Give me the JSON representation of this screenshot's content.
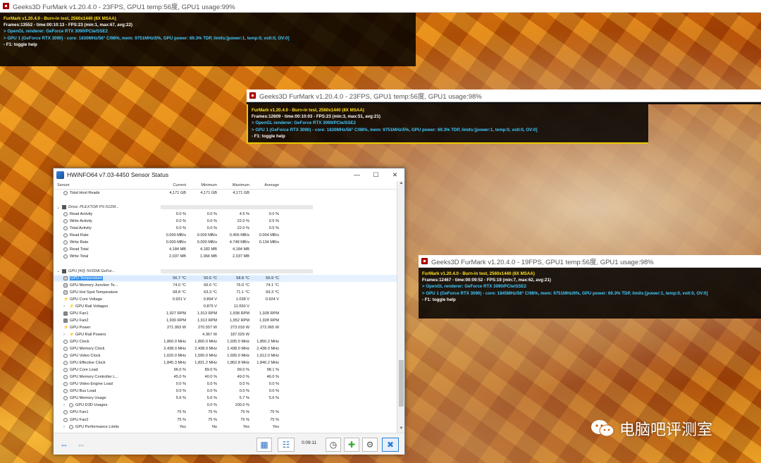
{
  "furmark_windows": [
    {
      "title": "Geeks3D FurMark v1.20.4.0 - 23FPS, GPU1 temp:56度, GPU1 usage:99%",
      "lines": [
        {
          "text": "FurMark v1.20.4.0 - Burn-in test, 2560x1440 (8X MSAA)",
          "color": "yellow"
        },
        {
          "text": "Frames:13552 - time:00:10:13 - FPS:23 (min:1, max:67, avg:22)",
          "color": "white"
        },
        {
          "text": "> OpenGL renderer: GeForce RTX 3090/PCIe/SSE2",
          "color": "cyan"
        },
        {
          "text": "> GPU 1 (GeForce RTX 3090) - core: 1830MHz/56° C/98%, mem: 9751MHz/5%, GPU power: 69.3% TDP, limits:[power:1, temp:0, volt:0, OV:0]",
          "color": "cyan"
        },
        {
          "text": "- F1: toggle help",
          "color": "white"
        }
      ]
    },
    {
      "title": "Geeks3D FurMark v1.20.4.0 - 23FPS, GPU1 temp:56度, GPU1 usage:98%",
      "lines": [
        {
          "text": "FurMark v1.20.4.0 - Burn-in test, 2560x1440 (8X MSAA)",
          "color": "yellow"
        },
        {
          "text": "Frames:12609 - time:00:10:03 - FPS:23 (min:3, max:51, avg:21)",
          "color": "white"
        },
        {
          "text": "> OpenGL renderer: GeForce RTX 3090/PCIe/SSE2",
          "color": "cyan"
        },
        {
          "text": "> GPU 1 (GeForce RTX 3090) - core: 1830MHz/56° C/98%, mem: 9751MHz/5%, GPU power: 69.3% TDP, limits:[power:1, temp:0, volt:0, OV:0]",
          "color": "cyan"
        },
        {
          "text": "- F1: toggle help",
          "color": "white"
        }
      ]
    },
    {
      "title": "Geeks3D FurMark v1.20.4.0 - 19FPS, GPU1 temp:56度, GPU1 usage:98%",
      "lines": [
        {
          "text": "FurMark v1.20.4.0 - Burn-in test, 2560x1440 (8X MSAA)",
          "color": "yellow"
        },
        {
          "text": "Frames:12467 - time:00:09:52 - FPS:19 (min:7, max:62, avg:21)",
          "color": "white"
        },
        {
          "text": "> OpenGL renderer: GeForce RTX 3090/PCIe/SSE2",
          "color": "cyan"
        },
        {
          "text": "> GPU 1 (GeForce RTX 3090) - core: 1845MHz/56° C/98%, mem: 9751MHz/6%, GPU power: 69.3% TDP, limits:[power:1, temp:0, volt:0, OV:0]",
          "color": "cyan"
        },
        {
          "text": "- F1: toggle help",
          "color": "white"
        }
      ]
    }
  ],
  "hwinfo": {
    "title": "HWiNFO64 v7.03-4450 Sensor Status",
    "columns": [
      "Sensor",
      "Current",
      "Minimum",
      "Maximum",
      "Average"
    ],
    "rows": [
      {
        "type": "item",
        "icon": "circle",
        "label": "Total Host Reads",
        "cur": "4,171 GB",
        "min": "4,171 GB",
        "max": "4,171 GB",
        "avg": ""
      },
      {
        "type": "blank"
      },
      {
        "type": "group",
        "label": "Drive: PLEXTOR PX-512M..."
      },
      {
        "type": "item",
        "icon": "circle",
        "label": "Read Activity",
        "cur": "0.0 %",
        "min": "0.0 %",
        "max": "4.5 %",
        "avg": "0.0 %"
      },
      {
        "type": "item",
        "icon": "circle",
        "label": "Write Activity",
        "cur": "0.0 %",
        "min": "0.0 %",
        "max": "22.0 %",
        "avg": "0.5 %"
      },
      {
        "type": "item",
        "icon": "circle",
        "label": "Total Activity",
        "cur": "0.0 %",
        "min": "0.0 %",
        "max": "22.0 %",
        "avg": "0.5 %"
      },
      {
        "type": "item",
        "icon": "circle",
        "label": "Read Rate",
        "cur": "0.000 MB/s",
        "min": "0.000 MB/s",
        "max": "0.456 MB/s",
        "avg": "0.004 MB/s"
      },
      {
        "type": "item",
        "icon": "circle",
        "label": "Write Rate",
        "cur": "0.000 MB/s",
        "min": "0.000 MB/s",
        "max": "4.748 MB/s",
        "avg": "0.134 MB/s"
      },
      {
        "type": "item",
        "icon": "circle",
        "label": "Read Total",
        "cur": "4,184 MB",
        "min": "4,182 MB",
        "max": "4,184 MB",
        "avg": ""
      },
      {
        "type": "item",
        "icon": "circle",
        "label": "Write Total",
        "cur": "2,037 MB",
        "min": "1,966 MB",
        "max": "2,037 MB",
        "avg": ""
      },
      {
        "type": "blank"
      },
      {
        "type": "group",
        "label": "GPU [#0]: NVIDIA GeFor..."
      },
      {
        "type": "item",
        "icon": "therm",
        "label": "GPU Temperature",
        "cur": "56.7 °C",
        "min": "50.5 °C",
        "max": "58.8 °C",
        "avg": "56.9 °C",
        "selected": true
      },
      {
        "type": "item",
        "icon": "therm",
        "label": "GPU Memory Junction Te...",
        "cur": "74.0 °C",
        "min": "66.0 °C",
        "max": "76.0 °C",
        "avg": "74.1 °C"
      },
      {
        "type": "item",
        "icon": "therm",
        "label": "GPU Hot Spot Temperature",
        "cur": "68.8 °C",
        "min": "63.3 °C",
        "max": "71.1 °C",
        "avg": "69.3 °C"
      },
      {
        "type": "item",
        "icon": "bolt",
        "label": "GPU Core Voltage",
        "cur": "0.931 V",
        "min": "0.894 V",
        "max": "1.038 V",
        "avg": "0.924 V"
      },
      {
        "type": "item",
        "icon": "bolt",
        "label": "GPU Rail Voltages",
        "cur": "",
        "min": "0.875 V",
        "max": "11.650 V",
        "avg": "",
        "expand": true
      },
      {
        "type": "item",
        "icon": "fan",
        "label": "GPU Fan1",
        "cur": "1,927 RPM",
        "min": "1,913 RPM",
        "max": "1,938 RPM",
        "avg": "1,928 RPM"
      },
      {
        "type": "item",
        "icon": "fan",
        "label": "GPU Fan2",
        "cur": "1,930 RPM",
        "min": "1,913 RPM",
        "max": "1,952 RPM",
        "avg": "1,928 RPM"
      },
      {
        "type": "item",
        "icon": "bolt",
        "label": "GPU Power",
        "cur": "271.993 W",
        "min": "270.557 W",
        "max": "273.018 W",
        "avg": "272.065 W"
      },
      {
        "type": "item",
        "icon": "bolt",
        "label": "GPU Rail Powers",
        "cur": "",
        "min": "4.367 W",
        "max": "187.029 W",
        "avg": "",
        "expand": true
      },
      {
        "type": "item",
        "icon": "circle",
        "label": "GPU Clock",
        "cur": "1,860.0 MHz",
        "min": "1,800.0 MHz",
        "max": "1,935.0 MHz",
        "avg": "1,850.2 MHz"
      },
      {
        "type": "item",
        "icon": "circle",
        "label": "GPU Memory Clock",
        "cur": "2,438.0 MHz",
        "min": "2,438.0 MHz",
        "max": "2,438.0 MHz",
        "avg": "2,438.0 MHz"
      },
      {
        "type": "item",
        "icon": "circle",
        "label": "GPU Video Clock",
        "cur": "1,620.0 MHz",
        "min": "1,590.0 MHz",
        "max": "1,695.0 MHz",
        "avg": "1,612.0 MHz"
      },
      {
        "type": "item",
        "icon": "circle",
        "label": "GPU Effective Clock",
        "cur": "1,845.3 MHz",
        "min": "1,831.2 MHz",
        "max": "1,862.8 MHz",
        "avg": "1,846.2 MHz"
      },
      {
        "type": "item",
        "icon": "circle",
        "label": "GPU Core Load",
        "cur": "96.0 %",
        "min": "89.0 %",
        "max": "99.0 %",
        "avg": "98.1 %"
      },
      {
        "type": "item",
        "icon": "circle",
        "label": "GPU Memory Controller L...",
        "cur": "45.0 %",
        "min": "40.0 %",
        "max": "49.0 %",
        "avg": "46.0 %"
      },
      {
        "type": "item",
        "icon": "circle",
        "label": "GPU Video Engine Load",
        "cur": "0.0 %",
        "min": "0.0 %",
        "max": "0.0 %",
        "avg": "0.0 %"
      },
      {
        "type": "item",
        "icon": "circle",
        "label": "GPU Bus Load",
        "cur": "0.0 %",
        "min": "0.0 %",
        "max": "0.0 %",
        "avg": "0.0 %"
      },
      {
        "type": "item",
        "icon": "circle",
        "label": "GPU Memory Usage",
        "cur": "5.6 %",
        "min": "5.6 %",
        "max": "5.7 %",
        "avg": "5.6 %"
      },
      {
        "type": "item",
        "icon": "circle",
        "label": "GPU D3D Usages",
        "cur": "",
        "min": "0.0 %",
        "max": "100.0 %",
        "avg": "",
        "expand": true
      },
      {
        "type": "item",
        "icon": "circle",
        "label": "GPU Fan1",
        "cur": "75 %",
        "min": "75 %",
        "max": "75 %",
        "avg": "75 %"
      },
      {
        "type": "item",
        "icon": "circle",
        "label": "GPU Fan2",
        "cur": "75 %",
        "min": "75 %",
        "max": "75 %",
        "avg": "75 %"
      },
      {
        "type": "item",
        "icon": "circle",
        "label": "GPU Performance Limits",
        "cur": "Yes",
        "min": "No",
        "max": "Yes",
        "avg": "Yes",
        "expand": true
      }
    ],
    "timer": "0:09:11"
  },
  "watermark": {
    "text": "电脑吧评测室"
  },
  "colors": {
    "hud_yellow": "#ffe020",
    "hud_cyan": "#40c8ff",
    "selection": "#3390ee"
  }
}
